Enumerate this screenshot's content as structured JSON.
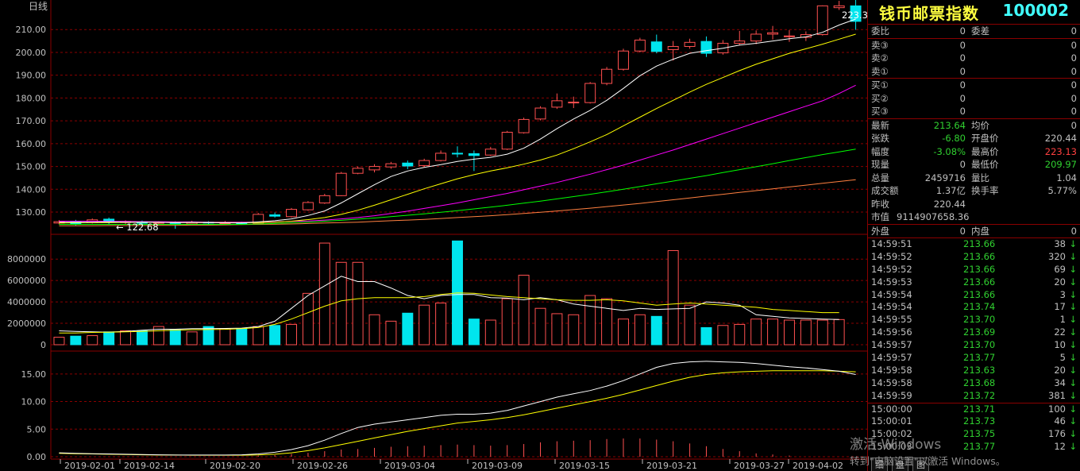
{
  "chart_data": {
    "type": "candlestick",
    "title": "日线",
    "x_labels": [
      "2019-02-01",
      "2019-02-14",
      "2019-02-20",
      "2019-02-26",
      "2019-03-04",
      "2019-03-09",
      "2019-03-15",
      "2019-03-21",
      "2019-03-27",
      "2019-04-02"
    ],
    "price_axis": {
      "ticks": [
        "210.00",
        "200.00",
        "190.00",
        "180.00",
        "170.00",
        "160.00",
        "150.00",
        "140.00",
        "130.00"
      ],
      "min_label": "122.68",
      "max_label": "223.32"
    },
    "volume_axis": {
      "ticks": [
        "8000000",
        "6000000",
        "4000000",
        "2000000",
        "0"
      ]
    },
    "indicator_axis": {
      "ticks": [
        "15.00",
        "10.00",
        "5.00",
        "0.00"
      ]
    },
    "candles": [
      {
        "o": 125.2,
        "c": 125.8,
        "h": 126.5,
        "l": 124.6
      },
      {
        "o": 126.0,
        "c": 124.9,
        "h": 126.6,
        "l": 124.2
      },
      {
        "o": 125.4,
        "c": 126.6,
        "h": 127.2,
        "l": 125.0
      },
      {
        "o": 126.9,
        "c": 125.6,
        "h": 127.6,
        "l": 124.8
      },
      {
        "o": 125.4,
        "c": 125.9,
        "h": 126.4,
        "l": 124.6
      },
      {
        "o": 125.8,
        "c": 125.1,
        "h": 126.3,
        "l": 124.5
      },
      {
        "o": 125.1,
        "c": 125.5,
        "h": 126.0,
        "l": 124.4
      },
      {
        "o": 125.5,
        "c": 125.0,
        "h": 126.0,
        "l": 122.7
      },
      {
        "o": 124.8,
        "c": 125.6,
        "h": 126.2,
        "l": 124.3
      },
      {
        "o": 125.6,
        "c": 125.2,
        "h": 126.0,
        "l": 124.6
      },
      {
        "o": 125.2,
        "c": 125.3,
        "h": 126.1,
        "l": 124.6
      },
      {
        "o": 125.3,
        "c": 124.9,
        "h": 125.8,
        "l": 124.4
      },
      {
        "o": 125.0,
        "c": 129.0,
        "h": 129.6,
        "l": 124.8
      },
      {
        "o": 128.8,
        "c": 128.2,
        "h": 129.8,
        "l": 127.6
      },
      {
        "o": 128.0,
        "c": 131.2,
        "h": 131.8,
        "l": 127.6
      },
      {
        "o": 131.0,
        "c": 134.2,
        "h": 134.8,
        "l": 130.6
      },
      {
        "o": 134.0,
        "c": 137.2,
        "h": 138.0,
        "l": 133.6
      },
      {
        "o": 137.2,
        "c": 147.0,
        "h": 147.6,
        "l": 137.0
      },
      {
        "o": 147.0,
        "c": 149.2,
        "h": 150.0,
        "l": 146.6
      },
      {
        "o": 148.5,
        "c": 150.0,
        "h": 151.0,
        "l": 147.4
      },
      {
        "o": 149.8,
        "c": 151.2,
        "h": 152.0,
        "l": 149.0
      },
      {
        "o": 151.5,
        "c": 150.2,
        "h": 152.6,
        "l": 148.8
      },
      {
        "o": 150.4,
        "c": 152.6,
        "h": 153.4,
        "l": 149.8
      },
      {
        "o": 152.6,
        "c": 155.8,
        "h": 157.0,
        "l": 152.2
      },
      {
        "o": 155.8,
        "c": 155.6,
        "h": 158.8,
        "l": 154.0
      },
      {
        "o": 155.6,
        "c": 154.8,
        "h": 157.0,
        "l": 148.0
      },
      {
        "o": 155.0,
        "c": 157.6,
        "h": 158.6,
        "l": 154.6
      },
      {
        "o": 157.6,
        "c": 165.0,
        "h": 165.6,
        "l": 157.2
      },
      {
        "o": 164.8,
        "c": 170.6,
        "h": 171.4,
        "l": 164.4
      },
      {
        "o": 170.8,
        "c": 175.6,
        "h": 176.4,
        "l": 170.2
      },
      {
        "o": 176.0,
        "c": 178.8,
        "h": 182.0,
        "l": 175.2
      },
      {
        "o": 178.0,
        "c": 178.2,
        "h": 180.6,
        "l": 175.6
      },
      {
        "o": 178.0,
        "c": 186.4,
        "h": 187.0,
        "l": 177.6
      },
      {
        "o": 186.4,
        "c": 192.6,
        "h": 193.6,
        "l": 185.6
      },
      {
        "o": 192.6,
        "c": 200.6,
        "h": 201.6,
        "l": 192.0
      },
      {
        "o": 200.6,
        "c": 205.4,
        "h": 206.4,
        "l": 200.0
      },
      {
        "o": 204.6,
        "c": 200.4,
        "h": 207.8,
        "l": 199.6
      },
      {
        "o": 201.2,
        "c": 202.6,
        "h": 205.0,
        "l": 196.4
      },
      {
        "o": 202.6,
        "c": 204.4,
        "h": 206.0,
        "l": 201.6
      },
      {
        "o": 204.8,
        "c": 199.6,
        "h": 207.0,
        "l": 198.0
      },
      {
        "o": 199.8,
        "c": 204.0,
        "h": 205.4,
        "l": 199.0
      },
      {
        "o": 204.0,
        "c": 205.0,
        "h": 209.4,
        "l": 203.0
      },
      {
        "o": 205.0,
        "c": 208.0,
        "h": 209.6,
        "l": 203.6
      },
      {
        "o": 208.0,
        "c": 208.6,
        "h": 211.6,
        "l": 205.6
      },
      {
        "o": 207.2,
        "c": 207.2,
        "h": 209.8,
        "l": 204.6
      },
      {
        "o": 206.6,
        "c": 207.8,
        "h": 209.2,
        "l": 205.0
      },
      {
        "o": 207.8,
        "c": 220.4,
        "h": 220.6,
        "l": 207.4
      },
      {
        "o": 219.6,
        "c": 220.4,
        "h": 222.6,
        "l": 218.6
      },
      {
        "o": 220.4,
        "c": 213.6,
        "h": 223.3,
        "l": 209.9
      }
    ],
    "ma_fast": [
      125.5,
      125.5,
      125.6,
      125.7,
      125.6,
      125.6,
      125.5,
      125.4,
      125.5,
      125.4,
      125.3,
      125.2,
      125.7,
      126.2,
      127.0,
      128.5,
      130.5,
      134.0,
      138.0,
      142.0,
      145.6,
      148.0,
      149.6,
      150.8,
      152.2,
      153.2,
      154.0,
      155.4,
      158.0,
      162.0,
      166.6,
      170.8,
      174.6,
      179.0,
      184.2,
      189.8,
      194.0,
      197.0,
      199.6,
      200.8,
      201.8,
      203.2,
      204.0,
      205.0,
      206.0,
      206.8,
      208.8,
      212.0,
      214.6
    ],
    "ma_mid": [
      125.2,
      125.3,
      125.4,
      125.4,
      125.5,
      125.5,
      125.5,
      125.4,
      125.4,
      125.4,
      125.4,
      125.3,
      125.4,
      125.6,
      126.0,
      126.7,
      127.6,
      129.0,
      130.8,
      133.0,
      135.4,
      137.8,
      140.2,
      142.4,
      144.6,
      146.4,
      148.0,
      149.4,
      151.0,
      152.8,
      155.0,
      157.8,
      160.8,
      164.0,
      167.8,
      171.6,
      175.4,
      179.0,
      182.6,
      186.0,
      189.0,
      192.0,
      194.8,
      197.2,
      199.6,
      201.6,
      203.6,
      205.8,
      208.0
    ],
    "ma_20": [
      126.0,
      126.0,
      126.0,
      125.9,
      125.9,
      125.8,
      125.8,
      125.7,
      125.7,
      125.6,
      125.6,
      125.6,
      125.6,
      125.7,
      125.9,
      126.1,
      126.5,
      127.0,
      127.6,
      128.4,
      129.4,
      130.4,
      131.6,
      132.8,
      134.0,
      135.4,
      136.8,
      138.2,
      139.8,
      141.4,
      143.0,
      144.8,
      146.6,
      148.6,
      150.6,
      152.8,
      155.0,
      157.2,
      159.6,
      162.0,
      164.4,
      166.8,
      169.2,
      171.6,
      174.0,
      176.4,
      178.8,
      182.0,
      185.6
    ],
    "ma_30": [
      124.6,
      124.6,
      124.6,
      124.6,
      124.6,
      124.6,
      124.6,
      124.6,
      124.6,
      124.6,
      124.6,
      124.6,
      124.8,
      125.0,
      125.3,
      125.6,
      126.0,
      126.4,
      126.9,
      127.4,
      128.0,
      128.6,
      129.2,
      129.9,
      130.6,
      131.4,
      132.2,
      133.0,
      133.9,
      134.8,
      135.8,
      136.8,
      137.8,
      138.9,
      140.0,
      141.2,
      142.4,
      143.6,
      144.8,
      146.0,
      147.3,
      148.6,
      149.9,
      151.2,
      152.6,
      153.9,
      155.2,
      156.4,
      157.6
    ],
    "ma_60": [
      124.0,
      124.0,
      124.0,
      124.1,
      124.1,
      124.1,
      124.2,
      124.2,
      124.3,
      124.3,
      124.4,
      124.5,
      124.6,
      124.7,
      124.8,
      125.0,
      125.2,
      125.4,
      125.6,
      125.9,
      126.2,
      126.5,
      126.8,
      127.2,
      127.6,
      128.0,
      128.4,
      128.9,
      129.4,
      129.9,
      130.5,
      131.1,
      131.7,
      132.4,
      133.1,
      133.8,
      134.6,
      135.4,
      136.2,
      137.0,
      137.8,
      138.6,
      139.4,
      140.2,
      141.0,
      141.8,
      142.6,
      143.4,
      144.2
    ],
    "volumes": [
      700000,
      800000,
      850000,
      1200000,
      1300000,
      1300000,
      1700000,
      1400000,
      1200000,
      1700000,
      1500000,
      1500000,
      1700000,
      1800000,
      1900000,
      4800000,
      9500000,
      7700000,
      7700000,
      2800000,
      2200000,
      2950000,
      3700000,
      3900000,
      9700000,
      2400000,
      2300000,
      4300000,
      6500000,
      3400000,
      2900000,
      2800000,
      4600000,
      4300000,
      2400000,
      2800000,
      2650000,
      8800000,
      3700000,
      1600000,
      1800000,
      1900000,
      2400000,
      2400000,
      2300000,
      2300000,
      2300000,
      2350000
    ],
    "vol_ma_fast": [
      1300000,
      1250000,
      1200000,
      1180000,
      1250000,
      1350000,
      1450000,
      1450000,
      1500000,
      1500000,
      1520000,
      1550000,
      1700000,
      2200000,
      3400000,
      4600000,
      5500000,
      6400000,
      5900000,
      5900000,
      5300000,
      4600000,
      4300000,
      4600000,
      4700000,
      4700000,
      4400000,
      4350000,
      4200000,
      4400000,
      4200000,
      3800000,
      3600000,
      3400000,
      3200000,
      3400000,
      3300000,
      3350000,
      3400000,
      4000000,
      3900000,
      3700000,
      2800000,
      2650000,
      2500000,
      2450000,
      2400000,
      2350000
    ],
    "vol_ma_slow": [
      1100000,
      1100000,
      1150000,
      1170000,
      1200000,
      1250000,
      1300000,
      1350000,
      1400000,
      1420000,
      1440000,
      1500000,
      1600000,
      1900000,
      2400000,
      3000000,
      3600000,
      4100000,
      4300000,
      4400000,
      4400000,
      4400000,
      4500000,
      4700000,
      4850000,
      4800000,
      4650000,
      4500000,
      4400000,
      4300000,
      4200000,
      4150000,
      4150000,
      4200000,
      4100000,
      3900000,
      3700000,
      3800000,
      3900000,
      3800000,
      3700000,
      3600000,
      3500000,
      3300000,
      3200000,
      3100000,
      3000000,
      3000000
    ],
    "indicator_white": [
      0.7,
      0.6,
      0.55,
      0.5,
      0.45,
      0.4,
      0.35,
      0.3,
      0.3,
      0.3,
      0.3,
      0.35,
      0.5,
      0.8,
      1.3,
      2.0,
      3.0,
      4.2,
      5.3,
      5.9,
      6.3,
      6.7,
      7.1,
      7.5,
      7.7,
      7.7,
      7.9,
      8.4,
      9.2,
      10.0,
      10.8,
      11.4,
      12.0,
      12.8,
      13.8,
      15.0,
      16.2,
      16.9,
      17.2,
      17.3,
      17.2,
      17.1,
      16.9,
      16.6,
      16.3,
      16.1,
      15.8,
      15.5,
      14.9
    ],
    "indicator_yellow": [
      0.6,
      0.55,
      0.5,
      0.45,
      0.4,
      0.35,
      0.3,
      0.3,
      0.28,
      0.27,
      0.27,
      0.28,
      0.32,
      0.45,
      0.7,
      1.1,
      1.6,
      2.2,
      2.8,
      3.4,
      4.0,
      4.6,
      5.1,
      5.6,
      6.1,
      6.4,
      6.7,
      7.1,
      7.6,
      8.2,
      8.8,
      9.4,
      10.0,
      10.6,
      11.3,
      12.1,
      12.9,
      13.7,
      14.4,
      14.9,
      15.2,
      15.4,
      15.5,
      15.6,
      15.6,
      15.6,
      15.6,
      15.5,
      15.4
    ],
    "indicator_bars": [
      0,
      0,
      0,
      0,
      0,
      0,
      0,
      0,
      0,
      0,
      0,
      0,
      0.2,
      0.3,
      0.5,
      0.7,
      1.0,
      1.3,
      1.4,
      1.6,
      1.8,
      1.9,
      2.0,
      2.1,
      2.2,
      2.1,
      2.0,
      2.1,
      2.3,
      2.6,
      2.8,
      2.9,
      3.0,
      3.2,
      3.3,
      3.3,
      3.1,
      2.8,
      2.4,
      1.9,
      1.4,
      1.0,
      0.6,
      0.4,
      0.2,
      0,
      0,
      0,
      0
    ]
  },
  "quote": {
    "name": "钱币邮票指数",
    "code": "100002",
    "weibi_label": "委比",
    "weibi": "0",
    "weicha_label": "委差",
    "weicha": "0",
    "asks": [
      {
        "label": "卖③",
        "price": "0",
        "vol": "0"
      },
      {
        "label": "卖②",
        "price": "0",
        "vol": "0"
      },
      {
        "label": "卖①",
        "price": "0",
        "vol": "0"
      }
    ],
    "bids": [
      {
        "label": "买①",
        "price": "0",
        "vol": "0"
      },
      {
        "label": "买②",
        "price": "0",
        "vol": "0"
      },
      {
        "label": "买③",
        "price": "0",
        "vol": "0"
      }
    ],
    "stats": [
      {
        "l1": "最新",
        "v1": "213.64",
        "l2": "均价",
        "v2": "0"
      },
      {
        "l1": "张跌",
        "v1": "-6.80",
        "l2": "开盘价",
        "v2": "220.44"
      },
      {
        "l1": "幅度",
        "v1": "-3.08%",
        "l2": "最高价",
        "v2": "223.13"
      },
      {
        "l1": "现量",
        "v1": "0",
        "l2": "最低价",
        "v2": "209.97"
      },
      {
        "l1": "总量",
        "v1": "2459716",
        "l2": "量比",
        "v2": "1.04"
      },
      {
        "l1": "成交额",
        "v1": "1.37亿",
        "l2": "换手率",
        "v2": "5.77%"
      },
      {
        "l1": "昨收",
        "v1": "220.44",
        "l2": "",
        "v2": ""
      }
    ],
    "market_value_label": "市值",
    "market_value": "9114907658.36",
    "outer_label": "外盘",
    "outer": "0",
    "inner_label": "内盘",
    "inner": "0",
    "ticks": [
      {
        "t": "14:59:51",
        "p": "213.66",
        "v": "38"
      },
      {
        "t": "14:59:52",
        "p": "213.66",
        "v": "320"
      },
      {
        "t": "14:59:52",
        "p": "213.66",
        "v": "69"
      },
      {
        "t": "14:59:53",
        "p": "213.66",
        "v": "20"
      },
      {
        "t": "14:59:54",
        "p": "213.66",
        "v": "3"
      },
      {
        "t": "14:59:54",
        "p": "213.74",
        "v": "17"
      },
      {
        "t": "14:59:55",
        "p": "213.70",
        "v": "1"
      },
      {
        "t": "14:59:56",
        "p": "213.69",
        "v": "22"
      },
      {
        "t": "14:59:57",
        "p": "213.70",
        "v": "10"
      },
      {
        "t": "14:59:57",
        "p": "213.77",
        "v": "5"
      },
      {
        "t": "14:59:58",
        "p": "213.63",
        "v": "20"
      },
      {
        "t": "14:59:58",
        "p": "213.68",
        "v": "34"
      },
      {
        "t": "14:59:59",
        "p": "213.72",
        "v": "381"
      },
      {
        "t": "15:00:00",
        "p": "213.71",
        "v": "100"
      },
      {
        "t": "15:00:01",
        "p": "213.73",
        "v": "46"
      },
      {
        "t": "15:00:02",
        "p": "213.75",
        "v": "176"
      },
      {
        "t": "15:00:03",
        "p": "213.77",
        "v": "12"
      }
    ],
    "arrow": "↓",
    "tabs": [
      "细",
      "盘",
      "图"
    ]
  },
  "watermark": {
    "line1": "激活 Windows",
    "line2": "转到\"电脑设置\"以激活 Windows。"
  },
  "colors": {
    "up": "#ff5050",
    "down": "#00e5ee",
    "grid": "#8a0000",
    "axis": "#c0c0c0",
    "ma_fast": "#ffffff",
    "ma_mid": "#ffff00",
    "ma_20": "#ff00ff",
    "ma_30": "#00ff00",
    "ma_60": "#ff8040"
  }
}
